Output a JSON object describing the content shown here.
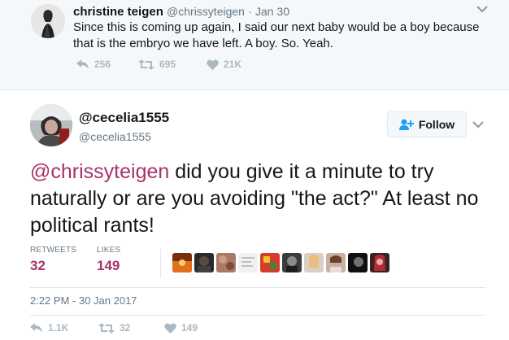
{
  "parent_tweet": {
    "author_name": "christine teigen",
    "author_handle": "@chrissyteigen",
    "separator": "·",
    "time": "Jan 30",
    "text": "Since this is coming up again, I said our next baby would be a boy because that is the embryo we have left. A boy. So. Yeah.",
    "replies": "256",
    "retweets": "695",
    "likes": "21K"
  },
  "main_tweet": {
    "author_name": "@cecelia1555",
    "author_handle": "@cecelia1555",
    "follow_label": "Follow",
    "mention": "@chrissyteigen",
    "text_rest": " did you give it a minute to try naturally or are you avoiding \"the act?\" At least no political rants!",
    "retweets_label": "RETWEETS",
    "retweets_value": "32",
    "likes_label": "LIKES",
    "likes_value": "149",
    "timestamp": "2:22 PM - 30 Jan 2017",
    "action_replies": "1.1K",
    "action_retweets": "32",
    "action_likes": "149"
  },
  "colors": {
    "accent": "#a8326b",
    "muted": "#657786",
    "action_icon": "#aab8c2",
    "parent_bg": "#f5f8fa",
    "follow_icon": "#1da1f2"
  },
  "icons": {
    "reply": "reply-icon",
    "retweet": "retweet-icon",
    "like": "heart-icon",
    "caret": "chevron-down-icon",
    "follow": "add-user-icon"
  },
  "liker_avatars": [
    "sunset",
    "dark-portrait",
    "floral",
    "sketch",
    "colorful-pattern",
    "gray-face",
    "blonde-woman",
    "smiling-woman",
    "dark-profile",
    "red-hair"
  ]
}
